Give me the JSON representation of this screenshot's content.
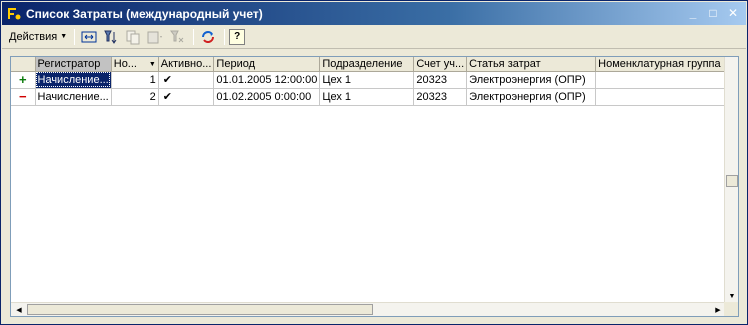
{
  "window": {
    "title": "Список Затраты (международный учет)",
    "buttons": [
      "_",
      "□",
      "✕"
    ]
  },
  "toolbar": {
    "actions_label": "Действия",
    "icons": [
      "expand-icon",
      "filter-icon",
      "copy-icon",
      "delete-icon",
      "clear-filter-icon",
      "refresh-icon",
      "help-icon"
    ],
    "help_label": "?"
  },
  "table": {
    "columns": [
      "",
      "Регистратор",
      "Но...",
      "Активно...",
      "Период",
      "Подразделение",
      "Счет уч...",
      "Статья затрат",
      "Номенклатурная группа"
    ],
    "rows": [
      {
        "sign": "+",
        "registrar": "Начисление...",
        "number": "1",
        "active": "✔",
        "period": "01.01.2005 12:00:00",
        "division": "Цех 1",
        "account": "20323",
        "cost_item": "Электроэнергия (ОПР)",
        "nomenclature_group": ""
      },
      {
        "sign": "−",
        "registrar": "Начисление...",
        "number": "2",
        "active": "✔",
        "period": "01.02.2005 0:00:00",
        "division": "Цех 1",
        "account": "20323",
        "cost_item": "Электроэнергия (ОПР)",
        "nomenclature_group": ""
      }
    ]
  },
  "colors": {
    "titlebar": "#0a246a",
    "selection": "#0a246a",
    "plus": "#0a7a0a",
    "minus": "#d00000"
  }
}
